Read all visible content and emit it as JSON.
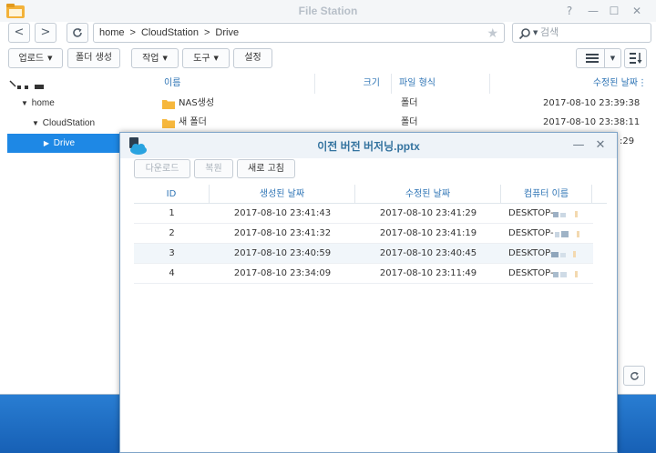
{
  "window": {
    "title": "File Station",
    "controls": {
      "help": "?",
      "minimize": "—",
      "maximize": "☐",
      "close": "✕"
    }
  },
  "nav": {
    "back": "<",
    "forward": ">",
    "refresh": "C"
  },
  "address": {
    "crumbs": [
      "home",
      "CloudStation",
      "Drive"
    ],
    "separator": ">"
  },
  "search": {
    "placeholder": "검색"
  },
  "toolbar": {
    "upload": "업로드",
    "new_folder": "폴더 생성",
    "action": "작업",
    "tools": "도구",
    "settings": "설정"
  },
  "tree": {
    "items": [
      {
        "label": "home",
        "expanded": true,
        "selected": false
      },
      {
        "label": "CloudStation",
        "expanded": true,
        "selected": false
      },
      {
        "label": "Drive",
        "expanded": false,
        "selected": true
      }
    ]
  },
  "file_list": {
    "columns": [
      "이름",
      "크기",
      "파일 형식",
      "수정된 날짜"
    ],
    "rows": [
      {
        "name": "NAS생성",
        "type": "폴더",
        "modified": "2017-08-10 23:39:38"
      },
      {
        "name": "새 폴더",
        "type": "폴더",
        "modified": "2017-08-10 23:38:11"
      },
      {
        "name": "",
        "type": "",
        "modified": ":29"
      }
    ]
  },
  "dialog": {
    "title": "이전 버전 버저닝.pptx",
    "buttons": {
      "download": "다운로드",
      "restore": "복원",
      "refresh": "새로 고침"
    },
    "columns": [
      "ID",
      "생성된 날짜",
      "수정된 날짜",
      "컴퓨터 이름"
    ],
    "rows": [
      {
        "id": "1",
        "created": "2017-08-10 23:41:43",
        "modified": "2017-08-10 23:41:29",
        "computer": "DESKTOP-"
      },
      {
        "id": "2",
        "created": "2017-08-10 23:41:32",
        "modified": "2017-08-10 23:41:19",
        "computer": "DESKTOP-"
      },
      {
        "id": "3",
        "created": "2017-08-10 23:40:59",
        "modified": "2017-08-10 23:40:45",
        "computer": "DESKTOP-"
      },
      {
        "id": "4",
        "created": "2017-08-10 23:34:09",
        "modified": "2017-08-10 23:11:49",
        "computer": "DESKTOP-"
      }
    ]
  },
  "colors": {
    "accent": "#1e88e5",
    "header_text": "#2e74b5",
    "folder": "#f6b73c"
  }
}
